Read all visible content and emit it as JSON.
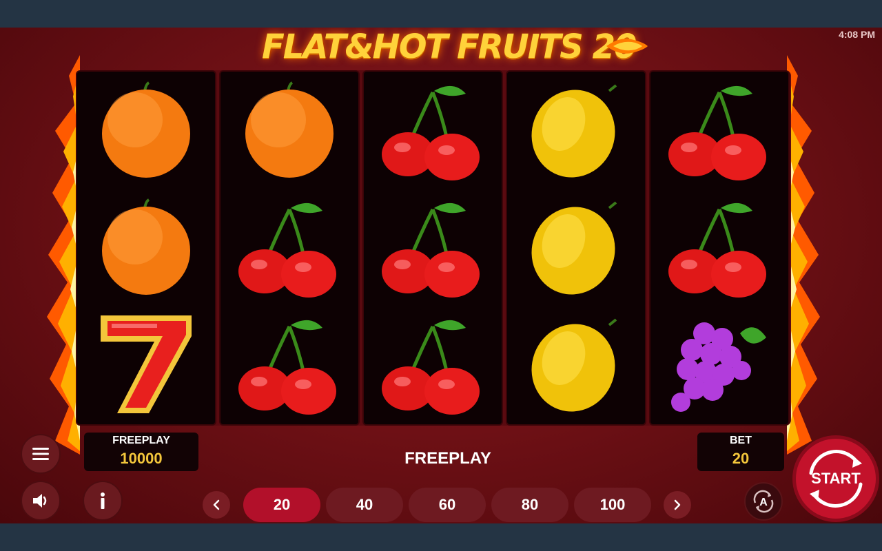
{
  "clock": "4:08 PM",
  "logo": {
    "text": "FLAT&HOT FRUITS 20"
  },
  "reels": [
    [
      "orange",
      "orange",
      "seven"
    ],
    [
      "orange",
      "cherry",
      "cherry"
    ],
    [
      "cherry",
      "cherry",
      "cherry"
    ],
    [
      "lemon",
      "lemon",
      "lemon"
    ],
    [
      "cherry",
      "cherry",
      "grapes"
    ]
  ],
  "balance": {
    "label": "FREEPLAY",
    "value": "10000"
  },
  "status": {
    "text": "FREEPLAY"
  },
  "bet": {
    "label": "BET",
    "value": "20"
  },
  "bet_options": [
    "20",
    "40",
    "60",
    "80",
    "100"
  ],
  "selected_bet_index": 0,
  "start": {
    "label": "START"
  },
  "icons": {
    "menu": "menu-icon",
    "sound": "speaker-icon",
    "info": "info-icon",
    "prev": "chevron-left-icon",
    "next": "chevron-right-icon",
    "auto": "autoplay-icon"
  },
  "colors": {
    "accent": "#b2102a",
    "gold": "#f3c63b",
    "background": "#6a0f14"
  }
}
